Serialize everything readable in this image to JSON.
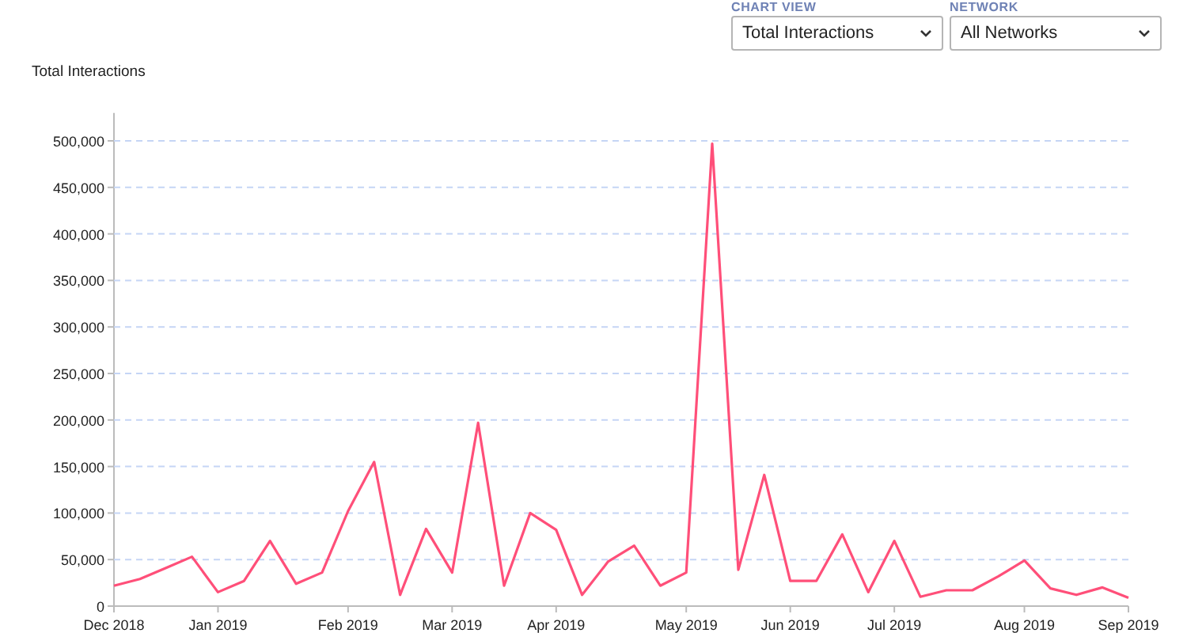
{
  "filters": [
    {
      "label": "CHART VIEW",
      "value": "Total Interactions"
    },
    {
      "label": "NETWORK",
      "value": "All Networks"
    }
  ],
  "chart": {
    "chart_data": {
      "type": "line",
      "ylabel": "Total Interactions",
      "categories": [
        "Dec 2018",
        null,
        null,
        null,
        "Jan 2019",
        null,
        null,
        null,
        null,
        "Feb 2019",
        null,
        null,
        null,
        "Mar 2019",
        null,
        null,
        null,
        "Apr 2019",
        null,
        null,
        null,
        null,
        "May 2019",
        null,
        null,
        null,
        "Jun 2019",
        null,
        null,
        null,
        "Jul 2019",
        null,
        null,
        null,
        null,
        "Aug 2019",
        null,
        null,
        null,
        "Sep 2019"
      ],
      "series": [
        {
          "color": "#ff4f79",
          "values": [
            22000,
            29000,
            41000,
            53000,
            15000,
            27000,
            70000,
            24000,
            36000,
            102000,
            155000,
            12000,
            83000,
            36000,
            197000,
            22000,
            100000,
            82000,
            12000,
            48000,
            65000,
            22000,
            36000,
            497000,
            39000,
            141000,
            27000,
            27000,
            77000,
            15000,
            70000,
            10000,
            17000,
            17000,
            32000,
            49000,
            19000,
            12000,
            20000,
            9000
          ]
        }
      ],
      "ylim": [
        0,
        530000
      ],
      "grid": true,
      "yticks": [
        {
          "value": 0,
          "label": "0"
        },
        {
          "value": 50000,
          "label": "50,000"
        },
        {
          "value": 100000,
          "label": "100,000"
        },
        {
          "value": 150000,
          "label": "150,000"
        },
        {
          "value": 200000,
          "label": "200,000"
        },
        {
          "value": 250000,
          "label": "250,000"
        },
        {
          "value": 300000,
          "label": "300,000"
        },
        {
          "value": 350000,
          "label": "350,000"
        },
        {
          "value": 400000,
          "label": "400,000"
        },
        {
          "value": 450000,
          "label": "450,000"
        },
        {
          "value": 500000,
          "label": "500,000"
        }
      ]
    }
  }
}
